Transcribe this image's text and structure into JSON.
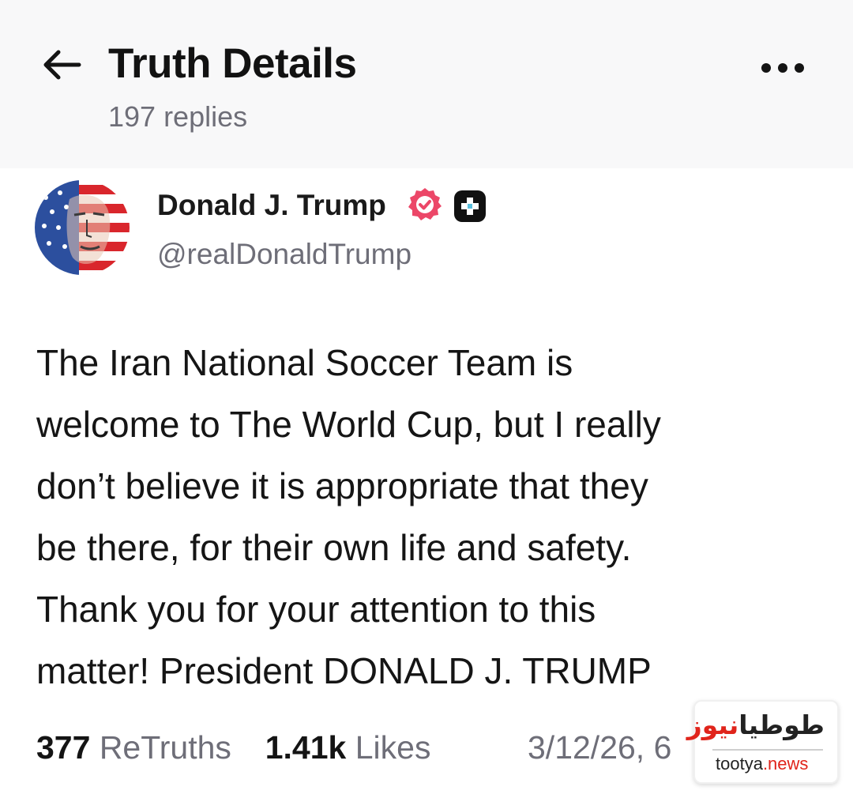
{
  "header": {
    "back_icon": "arrow-left-icon",
    "title": "Truth Details",
    "subtitle": "197 replies",
    "more_icon": "more-horizontal-icon"
  },
  "post": {
    "author": {
      "name": "Donald J. Trump",
      "handle": "@realDonaldTrump",
      "avatar": "flag-portrait-avatar",
      "verified_icon": "verified-badge-icon",
      "verified_color": "#ec4768",
      "plus_icon": "plus-badge-icon"
    },
    "body_lines": [
      "The Iran National Soccer Team is",
      "welcome to The World Cup, but I really",
      "don’t believe it is appropriate that they",
      "be there, for their own life and safety.",
      "Thank you for your attention to this",
      "matter! President DONALD J. TRUMP"
    ],
    "stats": {
      "retruths_count": "377",
      "retruths_label": "ReTruths",
      "likes_count": "1.41k",
      "likes_label": "Likes",
      "timestamp": "3/12/26, 6"
    }
  },
  "watermark": {
    "fa_part1": "طوطیا",
    "fa_part2": "نیوز",
    "en_part1": "tootya",
    "en_part2": ".news",
    "accent_color": "#e0241b"
  },
  "colors": {
    "header_bg": "#f8f8f9",
    "text_primary": "#111111",
    "text_secondary": "#6e6e78"
  }
}
